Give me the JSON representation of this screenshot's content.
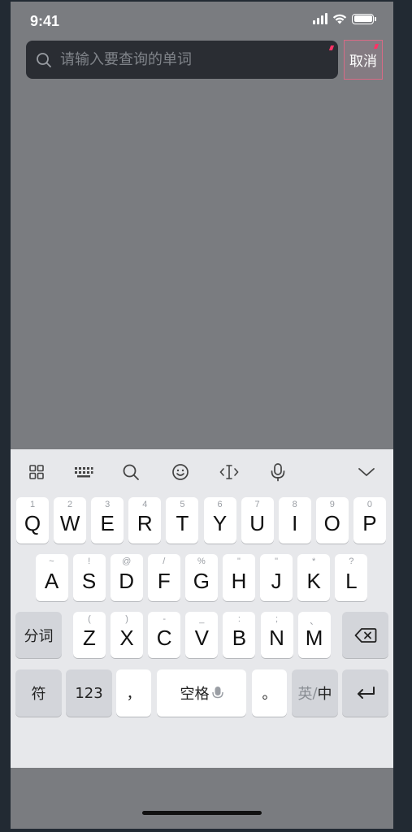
{
  "status_bar": {
    "time": "9:41"
  },
  "search": {
    "placeholder": "请输入要查询的单词",
    "value": "",
    "icon": "search-icon"
  },
  "cancel": {
    "label": "取消"
  },
  "keyboard": {
    "toolbar": [
      "grid-icon",
      "keyboard-layout-icon",
      "search-icon",
      "emoji-icon",
      "cursor-icon",
      "microphone-icon",
      "chevron-down-icon"
    ],
    "row1": [
      {
        "sub": "1",
        "main": "Q"
      },
      {
        "sub": "2",
        "main": "W"
      },
      {
        "sub": "3",
        "main": "E"
      },
      {
        "sub": "4",
        "main": "R"
      },
      {
        "sub": "5",
        "main": "T"
      },
      {
        "sub": "6",
        "main": "Y"
      },
      {
        "sub": "7",
        "main": "U"
      },
      {
        "sub": "8",
        "main": "I"
      },
      {
        "sub": "9",
        "main": "O"
      },
      {
        "sub": "0",
        "main": "P"
      }
    ],
    "row2": [
      {
        "sub": "~",
        "main": "A"
      },
      {
        "sub": "!",
        "main": "S"
      },
      {
        "sub": "@",
        "main": "D"
      },
      {
        "sub": "/",
        "main": "F"
      },
      {
        "sub": "%",
        "main": "G"
      },
      {
        "sub": "\"",
        "main": "H"
      },
      {
        "sub": "\"",
        "main": "J"
      },
      {
        "sub": "*",
        "main": "K"
      },
      {
        "sub": "?",
        "main": "L"
      }
    ],
    "row3": [
      {
        "sub": "(",
        "main": "Z"
      },
      {
        "sub": ")",
        "main": "X"
      },
      {
        "sub": "-",
        "main": "C"
      },
      {
        "sub": "_",
        "main": "V"
      },
      {
        "sub": ":",
        "main": "B"
      },
      {
        "sub": ";",
        "main": "N"
      },
      {
        "sub": "、",
        "main": "M"
      }
    ],
    "fenci": "分词",
    "symbols": "符",
    "numbers": "123",
    "comma": "，",
    "space": "空格",
    "period": "。",
    "lang_en": "英",
    "lang_sep": "/",
    "lang_zh": "中"
  }
}
